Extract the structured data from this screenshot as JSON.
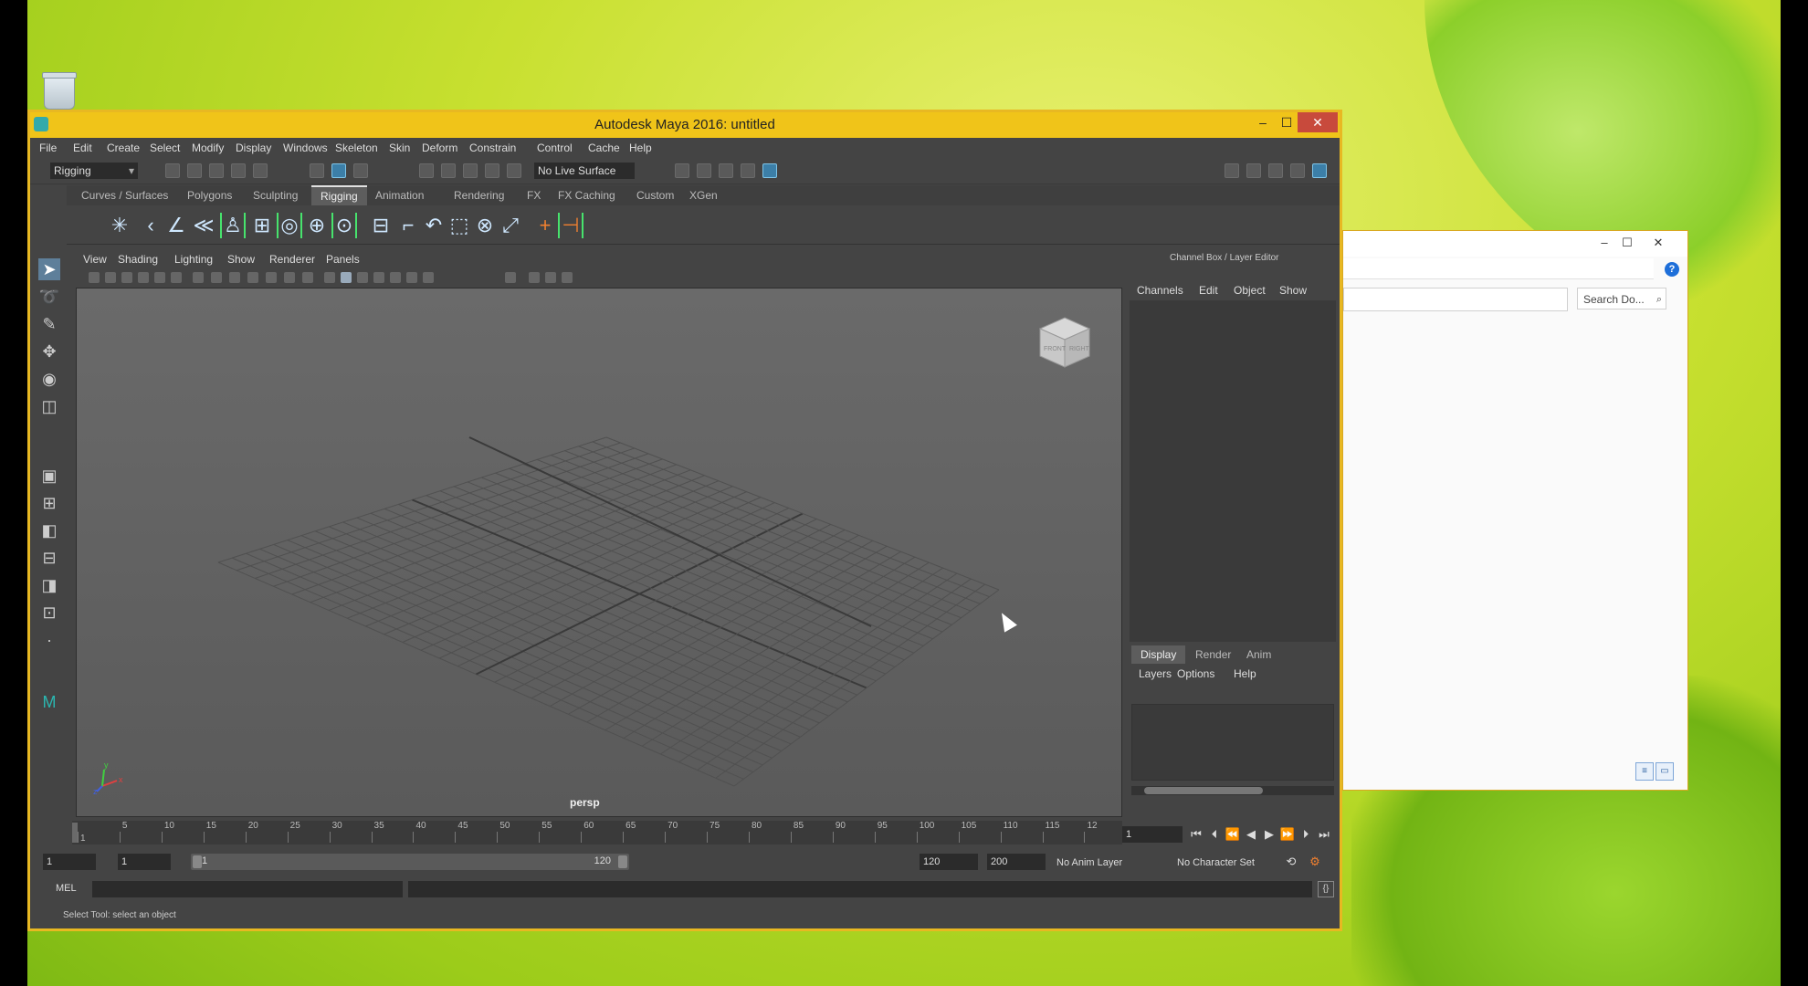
{
  "desktop": {
    "recycle_bin_icon": "recycle-bin-icon"
  },
  "explorer": {
    "search_placeholder": "Search Do...",
    "help_symbol": "?",
    "controls": [
      "–",
      "☐",
      "✕"
    ]
  },
  "maya": {
    "title": "Autodesk Maya 2016: untitled",
    "window_controls": {
      "minimize": "–",
      "maximize": "☐",
      "close": "✕"
    },
    "menus": [
      "File",
      "Edit",
      "Create",
      "Select",
      "Modify",
      "Display",
      "Windows",
      "Skeleton",
      "Skin",
      "Deform",
      "Constrain",
      "Control",
      "Cache",
      "Help"
    ],
    "menu_set": "Rigging",
    "live_surface": "No Live Surface",
    "shelf_tabs": [
      "Curves / Surfaces",
      "Polygons",
      "Sculpting",
      "Rigging",
      "Animation",
      "Rendering",
      "FX",
      "FX Caching",
      "Custom",
      "XGen"
    ],
    "active_shelf_tab": "Rigging",
    "viewport_menus": [
      "View",
      "Shading",
      "Lighting",
      "Show",
      "Renderer",
      "Panels"
    ],
    "viewcube": {
      "front": "FRONT",
      "right": "RIGHT"
    },
    "camera_label": "persp",
    "axes": {
      "x": "x",
      "y": "y",
      "z": "z"
    },
    "channel_box": {
      "title": "Channel Box / Layer Editor",
      "menus": [
        "Channels",
        "Edit",
        "Object",
        "Show"
      ],
      "layer_tabs": [
        "Display",
        "Render",
        "Anim"
      ],
      "active_layer_tab": "Display",
      "layer_menus": [
        "Layers",
        "Options",
        "Help"
      ]
    },
    "time_slider": {
      "ticks": [
        "1",
        "5",
        "10",
        "15",
        "20",
        "25",
        "30",
        "35",
        "40",
        "45",
        "50",
        "55",
        "60",
        "65",
        "70",
        "75",
        "80",
        "85",
        "90",
        "95",
        "100",
        "105",
        "110",
        "115",
        "12"
      ],
      "current_frame": "1"
    },
    "range": {
      "start": "1",
      "playback_start": "1",
      "slider_start": "1",
      "slider_end": "120",
      "playback_end": "120",
      "end": "200",
      "anim_layer": "No Anim Layer",
      "character_set": "No Character Set"
    },
    "command_line": {
      "lang": "MEL",
      "script_icon": "script-editor-icon"
    },
    "help_line": "Select Tool: select an object"
  }
}
